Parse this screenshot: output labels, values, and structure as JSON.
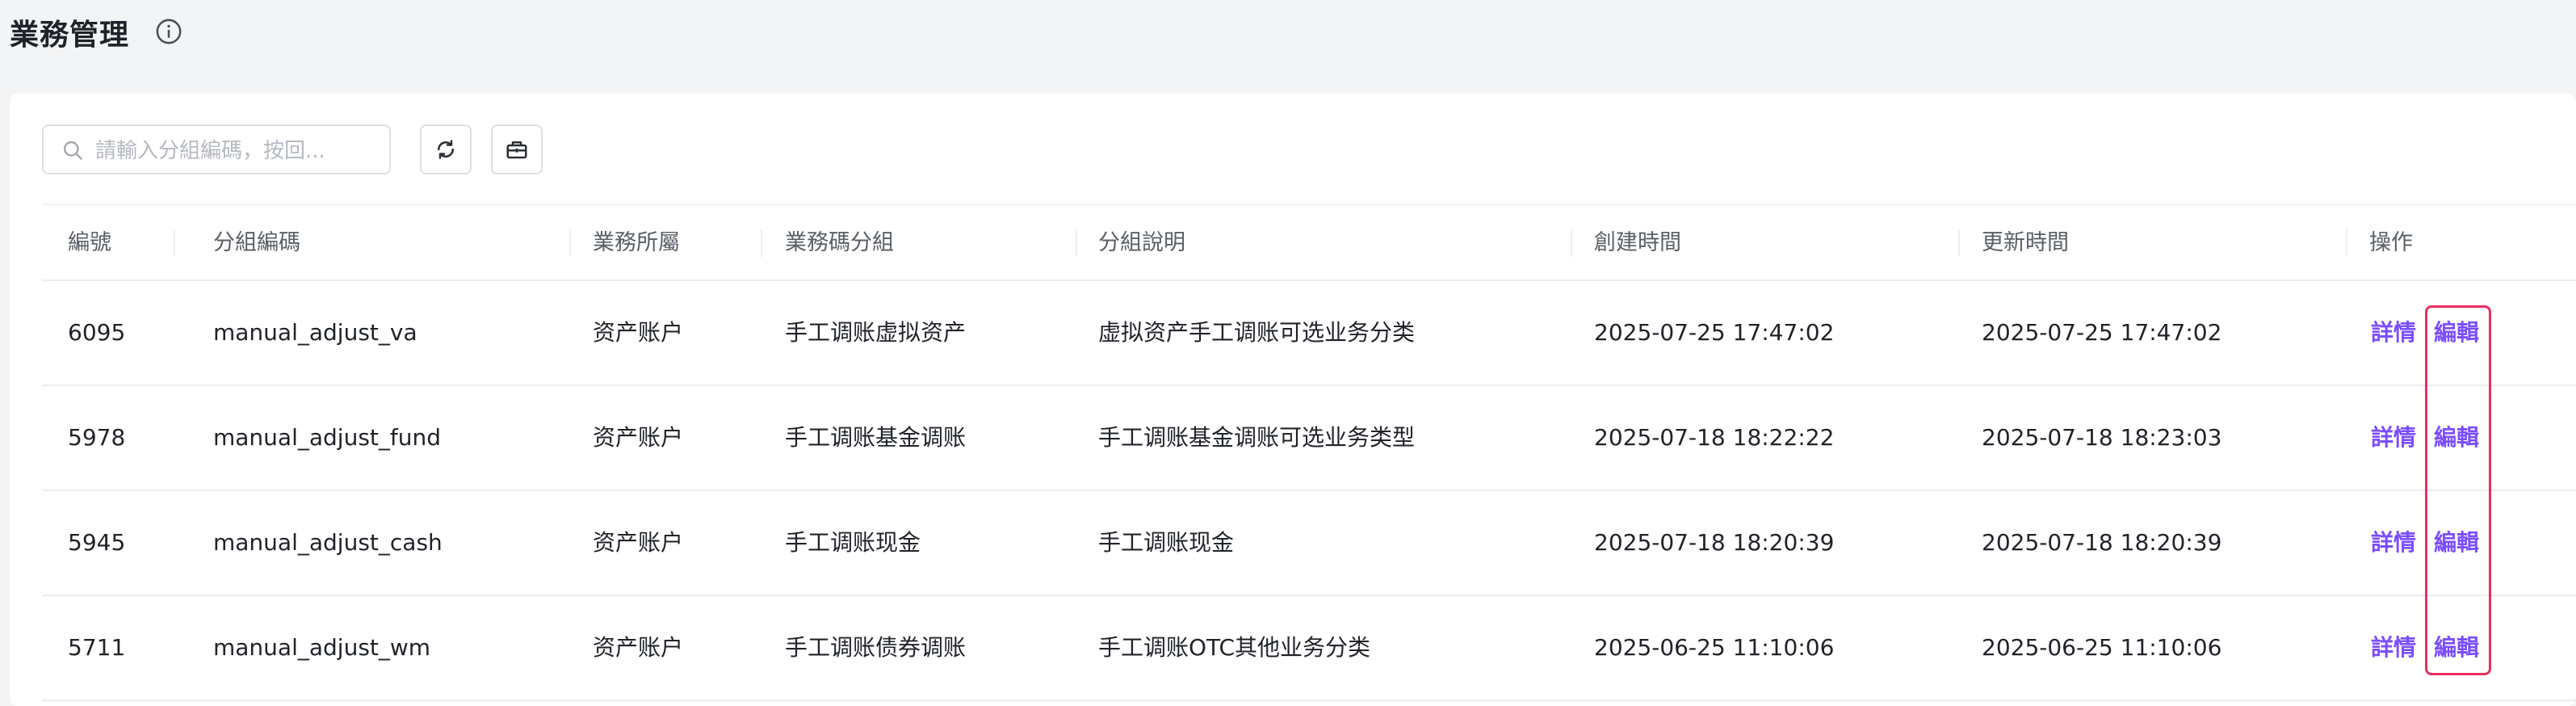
{
  "header": {
    "title": "業務管理"
  },
  "search": {
    "placeholder": "請輸入分組編碼，按回..."
  },
  "table": {
    "columns": {
      "id": "編號",
      "group_code": "分組編碼",
      "business_owner": "業務所屬",
      "business_code_group": "業務碼分組",
      "group_description": "分組說明",
      "created_at": "創建時間",
      "updated_at": "更新時間",
      "actions": "操作"
    },
    "rows": [
      {
        "id": "6095",
        "group_code": "manual_adjust_va",
        "business_owner": "资产账户",
        "business_code_group": "手工调账虚拟资产",
        "group_description": "虚拟资产手工调账可选业务分类",
        "created_at": "2025-07-25 17:47:02",
        "updated_at": "2025-07-25 17:47:02",
        "detail": "詳情",
        "edit": "編輯"
      },
      {
        "id": "5978",
        "group_code": "manual_adjust_fund",
        "business_owner": "资产账户",
        "business_code_group": "手工调账基金调账",
        "group_description": "手工调账基金调账可选业务类型",
        "created_at": "2025-07-18 18:22:22",
        "updated_at": "2025-07-18 18:23:03",
        "detail": "詳情",
        "edit": "編輯"
      },
      {
        "id": "5945",
        "group_code": "manual_adjust_cash",
        "business_owner": "资产账户",
        "business_code_group": "手工调账现金",
        "group_description": "手工调账现金",
        "created_at": "2025-07-18 18:20:39",
        "updated_at": "2025-07-18 18:20:39",
        "detail": "詳情",
        "edit": "編輯"
      },
      {
        "id": "5711",
        "group_code": "manual_adjust_wm",
        "business_owner": "资产账户",
        "business_code_group": "手工调账债券调账",
        "group_description": "手工调账OTC其他业务分类",
        "created_at": "2025-06-25 11:10:06",
        "updated_at": "2025-06-25 11:10:06",
        "detail": "詳情",
        "edit": "編輯"
      }
    ]
  },
  "colors": {
    "accent": "#7b4dff",
    "highlight": "#e8305c"
  }
}
